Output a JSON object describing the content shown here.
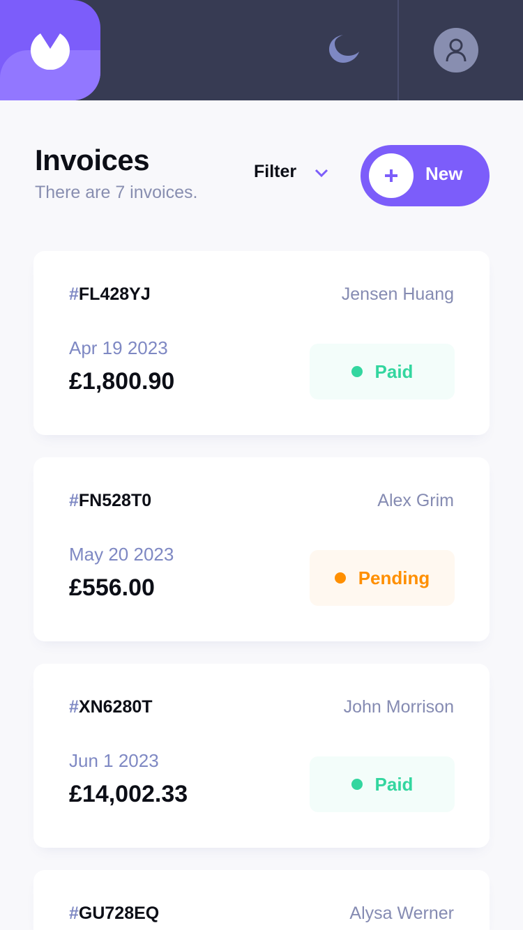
{
  "header": {
    "logo_icon": "logo-icon",
    "theme_icon": "moon-icon",
    "avatar_icon": "user-icon",
    "colors": {
      "bar": "#373B53",
      "logo": "#7C5DFA",
      "logo_light": "#9277FF"
    }
  },
  "page": {
    "title": "Invoices",
    "subtitle": "There are 7 invoices.",
    "filter_label": "Filter",
    "new_label": "New"
  },
  "invoices": [
    {
      "id_hash": "#",
      "id": "FL428YJ",
      "client": "Jensen Huang",
      "due": "Apr 19 2023",
      "amount": "£1,800.90",
      "status": "Paid"
    },
    {
      "id_hash": "#",
      "id": "FN528T0",
      "client": "Alex Grim",
      "due": "May 20 2023",
      "amount": "£556.00",
      "status": "Pending"
    },
    {
      "id_hash": "#",
      "id": "XN6280T",
      "client": "John Morrison",
      "due": "Jun 1 2023",
      "amount": "£14,002.33",
      "status": "Paid"
    },
    {
      "id_hash": "#",
      "id": "GU728EQ",
      "client": "Alysa Werner",
      "due": "",
      "amount": "",
      "status": ""
    }
  ],
  "status_colors": {
    "paid": "#33D69F",
    "pending": "#FF8F00",
    "accent": "#7C5DFA"
  }
}
